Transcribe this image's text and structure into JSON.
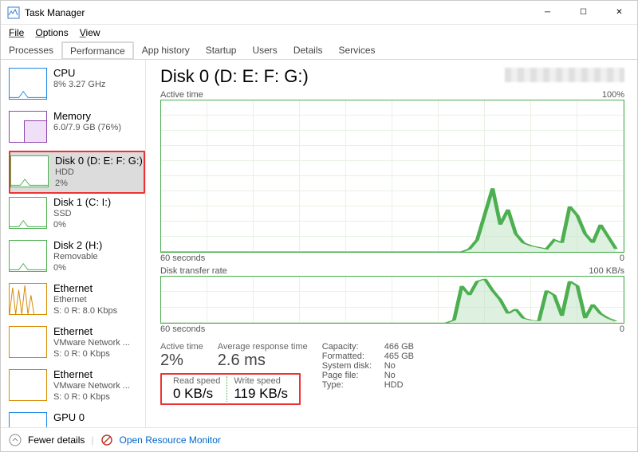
{
  "window": {
    "title": "Task Manager"
  },
  "menu": {
    "file": "File",
    "options": "Options",
    "view": "View"
  },
  "tabs": [
    "Processes",
    "Performance",
    "App history",
    "Startup",
    "Users",
    "Details",
    "Services"
  ],
  "active_tab": 1,
  "sidebar": [
    {
      "name": "CPU",
      "sub": "8% 3.27 GHz",
      "color": "#1e88e5"
    },
    {
      "name": "Memory",
      "sub": "6.0/7.9 GB (76%)",
      "color": "#8e44ad"
    },
    {
      "name": "Disk 0 (D: E: F: G:)",
      "sub": "HDD",
      "sub2": "2%",
      "color": "#4caf50",
      "selected": true,
      "highlighted": true
    },
    {
      "name": "Disk 1 (C: I:)",
      "sub": "SSD",
      "sub2": "0%",
      "color": "#4caf50"
    },
    {
      "name": "Disk 2 (H:)",
      "sub": "Removable",
      "sub2": "0%",
      "color": "#4caf50"
    },
    {
      "name": "Ethernet",
      "sub": "Ethernet",
      "sub2": "S: 0 R: 8.0 Kbps",
      "color": "#d68a00"
    },
    {
      "name": "Ethernet",
      "sub": "VMware Network ...",
      "sub2": "S: 0 R: 0 Kbps",
      "color": "#d68a00"
    },
    {
      "name": "Ethernet",
      "sub": "VMware Network ...",
      "sub2": "S: 0 R: 0 Kbps",
      "color": "#d68a00"
    },
    {
      "name": "GPU 0",
      "sub": "",
      "color": "#1e88e5"
    }
  ],
  "main": {
    "title": "Disk 0 (D: E: F: G:)",
    "chart1_label": "Active time",
    "chart1_max": "100%",
    "chart2_label": "Disk transfer rate",
    "chart2_max": "100 KB/s",
    "xaxis_left": "60 seconds",
    "xaxis_right": "0",
    "stats": {
      "active_time_label": "Active time",
      "active_time_value": "2%",
      "avg_resp_label": "Average response time",
      "avg_resp_value": "2.6 ms",
      "read_label": "Read speed",
      "read_value": "0 KB/s",
      "write_label": "Write speed",
      "write_value": "119 KB/s"
    },
    "details": {
      "capacity_k": "Capacity:",
      "capacity_v": "466 GB",
      "formatted_k": "Formatted:",
      "formatted_v": "465 GB",
      "sysdisk_k": "System disk:",
      "sysdisk_v": "No",
      "pagefile_k": "Page file:",
      "pagefile_v": "No",
      "type_k": "Type:",
      "type_v": "HDD"
    }
  },
  "footer": {
    "fewer": "Fewer details",
    "orm": "Open Resource Monitor"
  },
  "chart_data": {
    "type": "line",
    "title": "Disk 0 Active time & transfer rate",
    "xlabel": "seconds",
    "x_range": [
      60,
      0
    ],
    "series": [
      {
        "name": "Active time %",
        "ylim": [
          0,
          100
        ],
        "values": [
          0,
          0,
          0,
          0,
          0,
          0,
          0,
          0,
          0,
          0,
          0,
          0,
          0,
          0,
          0,
          0,
          0,
          0,
          0,
          0,
          0,
          0,
          0,
          0,
          0,
          0,
          0,
          0,
          0,
          0,
          0,
          0,
          0,
          0,
          0,
          0,
          0,
          0,
          0,
          0,
          2,
          8,
          25,
          42,
          18,
          28,
          12,
          6,
          4,
          3,
          2,
          8,
          6,
          30,
          24,
          12,
          6,
          18,
          10,
          2
        ]
      },
      {
        "name": "Transfer rate KB/s",
        "ylim": [
          0,
          100
        ],
        "values": [
          0,
          0,
          0,
          0,
          0,
          0,
          0,
          0,
          0,
          0,
          0,
          0,
          0,
          0,
          0,
          0,
          0,
          0,
          0,
          0,
          0,
          0,
          0,
          0,
          0,
          0,
          0,
          0,
          0,
          0,
          0,
          0,
          0,
          0,
          0,
          0,
          0,
          0,
          6,
          80,
          60,
          90,
          95,
          70,
          50,
          20,
          30,
          10,
          6,
          4,
          70,
          60,
          15,
          90,
          80,
          10,
          40,
          20,
          10,
          4
        ]
      }
    ]
  }
}
